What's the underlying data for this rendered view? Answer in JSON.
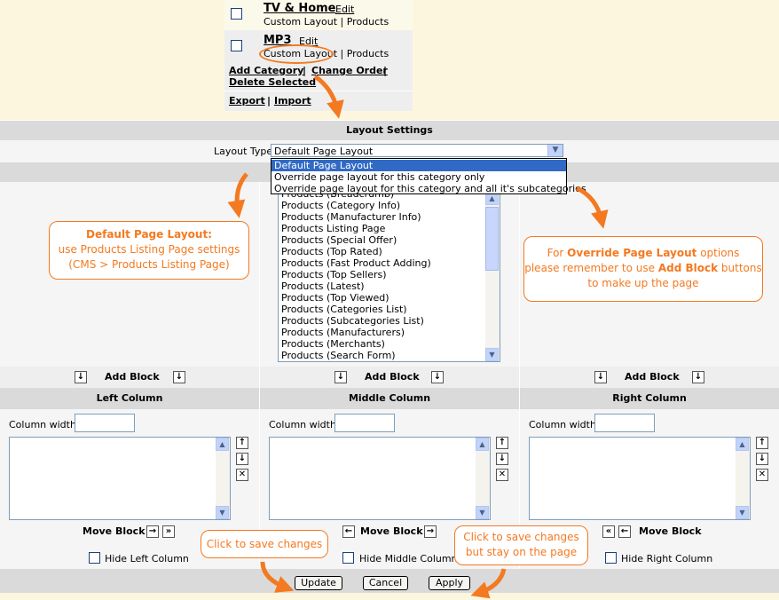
{
  "categories": [
    {
      "name": "TV & Home",
      "edit": "Edit",
      "subtitle": "Custom Layout | Products"
    },
    {
      "name": "MP3",
      "edit": "Edit",
      "subtitle": "Custom Layout | Products"
    }
  ],
  "category_actions": {
    "add": "Add Category",
    "order": "Change Order",
    "delete": "Delete Selected",
    "export": "Export",
    "import": "Import",
    "separator": "|"
  },
  "layout_settings": {
    "title": "Layout Settings",
    "type_label": "Layout Type",
    "selected": "Default Page Layout",
    "options": [
      "Default Page Layout",
      "Override page layout for this category only",
      "Override page layout for this category and all it's subcategories"
    ]
  },
  "block_list": {
    "partial_top": "Products (Breadcrumb)",
    "items": [
      "Products (Category Info)",
      "Products (Manufacturer Info)",
      "Products Listing Page",
      "Products (Special Offer)",
      "Products (Top Rated)",
      "Products (Fast Product Adding)",
      "Products (Top Sellers)",
      "Products (Latest)",
      "Products (Top Viewed)",
      "Products (Categories List)",
      "Products (Subcategories List)",
      "Products (Manufacturers)",
      "Products (Merchants)",
      "Products (Search Form)"
    ]
  },
  "add_block_label": "Add Block",
  "columns": {
    "left": {
      "title": "Left Column",
      "width_label": "Column width",
      "move_label": "Move Block",
      "hide_label": "Hide Left Column"
    },
    "middle": {
      "title": "Middle Column",
      "width_label": "Column width",
      "move_label": "Move Block",
      "hide_label": "Hide Middle Column"
    },
    "right": {
      "title": "Right Column",
      "width_label": "Column width",
      "move_label": "Move Block",
      "hide_label": "Hide Right Column"
    }
  },
  "buttons": {
    "update": "Update",
    "cancel": "Cancel",
    "apply": "Apply"
  },
  "callouts": {
    "default_title": "Default Page Layout:",
    "default_line2": "use Products Listing Page settings",
    "default_line3": "(CMS > Products Listing Page)",
    "override_pre": "For ",
    "override_bold1": "Override Page Layout",
    "override_mid1": " options",
    "override_line2_pre": "please remember to use ",
    "override_bold2": "Add Block",
    "override_line2_post": " buttons",
    "override_line3": "to make up the page",
    "save": "Click to save changes",
    "save_stay_line1": "Click to save changes",
    "save_stay_line2": "but stay on the page"
  },
  "colors": {
    "accent": "#f47920",
    "selection": "#316ac5",
    "header_bg": "#dadada"
  }
}
